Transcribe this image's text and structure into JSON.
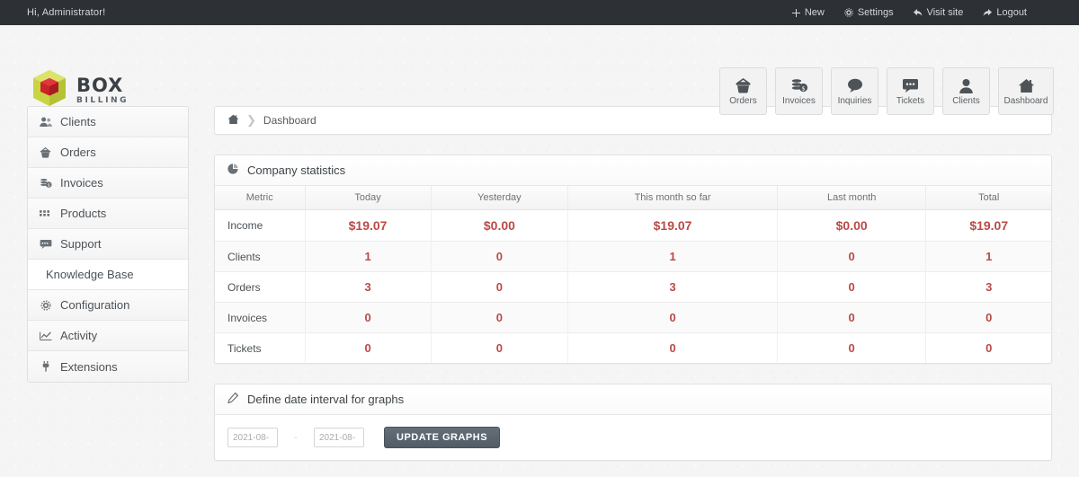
{
  "topbar": {
    "greeting": "Hi, Administrator!",
    "links": [
      {
        "label": "New",
        "icon": "plus-icon"
      },
      {
        "label": "Settings",
        "icon": "gear-icon"
      },
      {
        "label": "Visit site",
        "icon": "back-arrow-icon"
      },
      {
        "label": "Logout",
        "icon": "logout-arrow-icon"
      }
    ]
  },
  "brand": {
    "name": "BOX",
    "suffix": "BILLING"
  },
  "toolbar": {
    "buttons": [
      {
        "label": "Orders",
        "icon": "basket-icon"
      },
      {
        "label": "Invoices",
        "icon": "coins-icon"
      },
      {
        "label": "Inquiries",
        "icon": "speech-bubble-icon"
      },
      {
        "label": "Tickets",
        "icon": "chat-dots-icon"
      },
      {
        "label": "Clients",
        "icon": "person-icon"
      },
      {
        "label": "Dashboard",
        "icon": "house-icon"
      }
    ]
  },
  "sidebar": {
    "items": [
      {
        "label": "Clients",
        "icon": "people-icon",
        "sub": false
      },
      {
        "label": "Orders",
        "icon": "basket-icon",
        "sub": false
      },
      {
        "label": "Invoices",
        "icon": "coins-icon",
        "sub": false
      },
      {
        "label": "Products",
        "icon": "grid-icon",
        "sub": false
      },
      {
        "label": "Support",
        "icon": "chat-icon",
        "sub": false
      },
      {
        "label": "Knowledge Base",
        "icon": "",
        "sub": true
      },
      {
        "label": "Configuration",
        "icon": "gear-icon",
        "sub": false
      },
      {
        "label": "Activity",
        "icon": "chart-icon",
        "sub": false
      },
      {
        "label": "Extensions",
        "icon": "plug-icon",
        "sub": false
      }
    ]
  },
  "breadcrumb": {
    "home_icon": "home-icon",
    "current": "Dashboard"
  },
  "statistics": {
    "title": "Company statistics",
    "icon": "pie-chart-icon",
    "columns": [
      "Metric",
      "Today",
      "Yesterday",
      "This month so far",
      "Last month",
      "Total"
    ],
    "rows": [
      {
        "metric": "Income",
        "today": "$19.07",
        "yesterday": "$0.00",
        "month": "$19.07",
        "last_month": "$0.00",
        "total": "$19.07",
        "money": true
      },
      {
        "metric": "Clients",
        "today": "1",
        "yesterday": "0",
        "month": "1",
        "last_month": "0",
        "total": "1",
        "money": false
      },
      {
        "metric": "Orders",
        "today": "3",
        "yesterday": "0",
        "month": "3",
        "last_month": "0",
        "total": "3",
        "money": false
      },
      {
        "metric": "Invoices",
        "today": "0",
        "yesterday": "0",
        "month": "0",
        "last_month": "0",
        "total": "0",
        "money": false
      },
      {
        "metric": "Tickets",
        "today": "0",
        "yesterday": "0",
        "month": "0",
        "last_month": "0",
        "total": "0",
        "money": false
      }
    ]
  },
  "date_interval": {
    "title": "Define date interval for graphs",
    "icon": "pencil-icon",
    "from_value": "2021-08-",
    "to_value": "2021-08-",
    "separator": "-",
    "update_label": "UPDATE GRAPHS"
  },
  "colors": {
    "topbar_bg": "#2d3135",
    "value_red": "#b94a48",
    "button_dark": "#525c66",
    "logo_green": "#cddc39",
    "logo_red": "#cc2229"
  }
}
